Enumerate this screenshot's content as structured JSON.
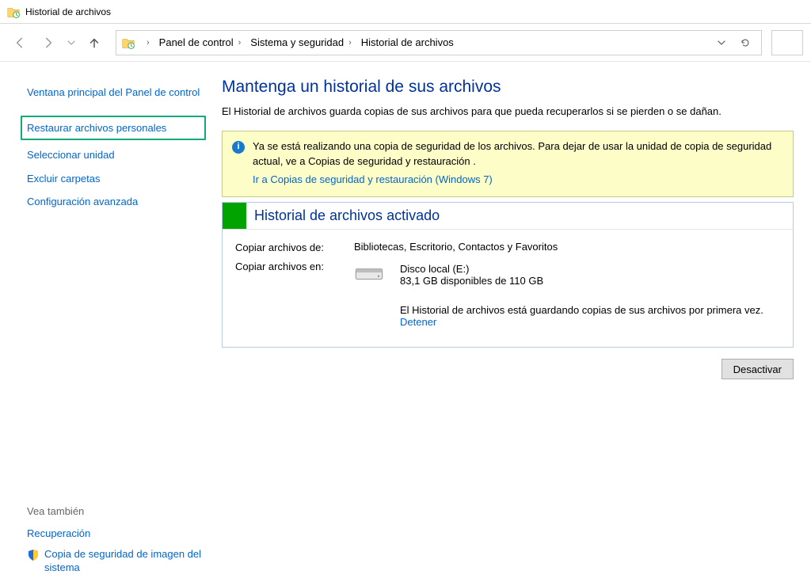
{
  "window": {
    "title": "Historial de archivos"
  },
  "breadcrumbs": {
    "item0": "Panel de control",
    "item1": "Sistema y seguridad",
    "item2": "Historial de archivos"
  },
  "sidebar": {
    "main_panel": "Ventana principal del Panel de control",
    "restore": "Restaurar archivos personales",
    "select_drive": "Seleccionar unidad",
    "exclude": "Excluir carpetas",
    "advanced": "Configuración avanzada",
    "see_also_head": "Vea también",
    "recovery": "Recuperación",
    "system_image": "Copia de seguridad de imagen del sistema"
  },
  "main": {
    "heading": "Mantenga un historial de sus archivos",
    "subtitle": "El Historial de archivos guarda copias de sus archivos para que pueda recuperarlos si se pierden o se dañan.",
    "notice_text": "Ya se está realizando una copia de seguridad de los archivos. Para dejar de usar la unidad de copia de seguridad actual, ve a Copias de seguridad y restauración .",
    "notice_link": "Ir a Copias de seguridad y restauración (Windows 7)",
    "status_title": "Historial de archivos activado",
    "copy_from_label": "Copiar archivos de:",
    "copy_from_value": "Bibliotecas, Escritorio, Contactos y Favoritos",
    "copy_to_label": "Copiar archivos en:",
    "disk_name": "Disco local (E:)",
    "disk_space": "83,1 GB disponibles de 110 GB",
    "saving_msg": "El Historial de archivos está guardando copias de sus archivos por primera vez.",
    "stop_link": "Detener",
    "deactivate_btn": "Desactivar"
  }
}
